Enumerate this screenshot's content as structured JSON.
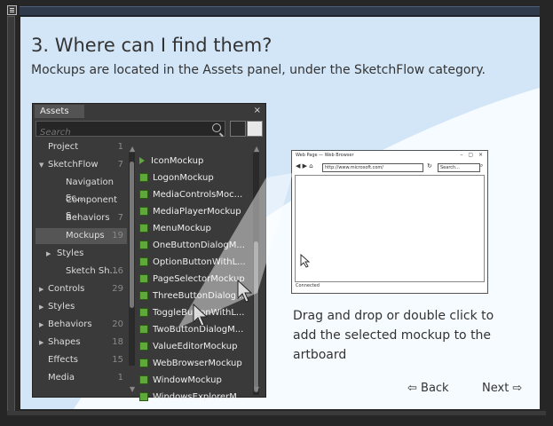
{
  "slide": {
    "heading": "3. Where can I find them?",
    "subheading": "Mockups are located in the Assets panel, under the SketchFlow category."
  },
  "assets_panel": {
    "tab_label": "Assets",
    "close_label": "×",
    "search_placeholder": "Search",
    "categories": [
      {
        "label": "Project",
        "count": "1",
        "indent": 0,
        "arrow": ""
      },
      {
        "label": "SketchFlow",
        "count": "7",
        "indent": 0,
        "arrow": "▼"
      },
      {
        "label": "Navigation Sc...",
        "count": "",
        "indent": 2,
        "arrow": ""
      },
      {
        "label": "Component S...",
        "count": "",
        "indent": 2,
        "arrow": ""
      },
      {
        "label": "Behaviors",
        "count": "7",
        "indent": 2,
        "arrow": ""
      },
      {
        "label": "Mockups",
        "count": "19",
        "indent": 2,
        "arrow": "",
        "selected": true
      },
      {
        "label": "Styles",
        "count": "",
        "indent": 1,
        "arrow": "▶"
      },
      {
        "label": "Sketch Sh...",
        "count": "16",
        "indent": 2,
        "arrow": ""
      },
      {
        "label": "Controls",
        "count": "29",
        "indent": 0,
        "arrow": "▶"
      },
      {
        "label": "Styles",
        "count": "",
        "indent": 0,
        "arrow": "▶"
      },
      {
        "label": "Behaviors",
        "count": "20",
        "indent": 0,
        "arrow": "▶"
      },
      {
        "label": "Shapes",
        "count": "18",
        "indent": 0,
        "arrow": "▶"
      },
      {
        "label": "Effects",
        "count": "15",
        "indent": 0,
        "arrow": ""
      },
      {
        "label": "Media",
        "count": "1",
        "indent": 0,
        "arrow": ""
      }
    ],
    "items": [
      "IconMockup",
      "LogonMockup",
      "MediaControlsMoc...",
      "MediaPlayerMockup",
      "MenuMockup",
      "OneButtonDialogM...",
      "OptionButtonWithL...",
      "PageSelectorMockup",
      "ThreeButtonDialog...",
      "ToggleButtonWithL...",
      "TwoButtonDialogM...",
      "ValueEditorMockup",
      "WebBrowserMockup",
      "WindowMockup",
      "WindowsExplorerM..."
    ]
  },
  "browser_mock": {
    "title": "Web Page — Web Browser",
    "window_buttons": "– ▢ ×",
    "address": "http://www.microsoft.com/",
    "search": "Search...",
    "status": "Connected"
  },
  "instruction": "Drag and drop or double click to add the selected mockup to the artboard",
  "nav": {
    "back": "⇦ Back",
    "next": "Next ⇨"
  },
  "colors": {
    "slide_bg": "#e4f0fb",
    "panel_bg": "#3a3a3a",
    "mockup_icon": "#5fa83a"
  }
}
